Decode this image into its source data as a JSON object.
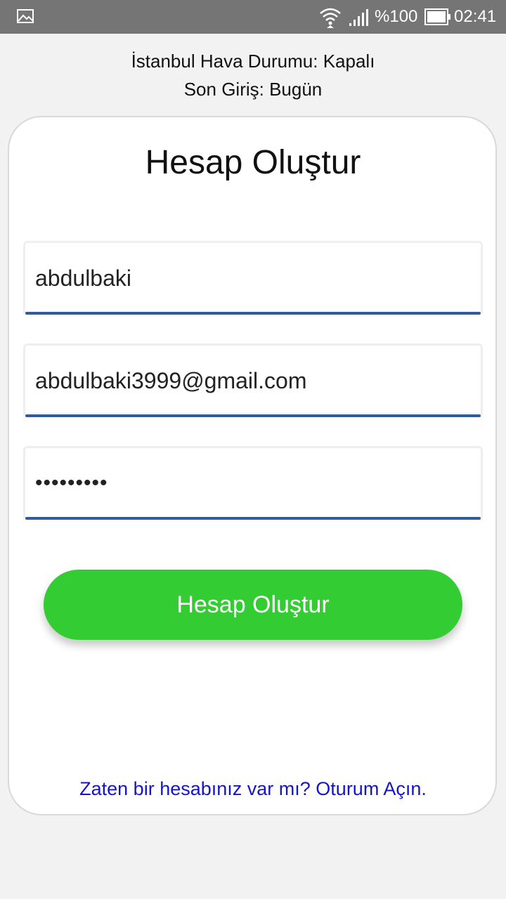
{
  "status_bar": {
    "battery_percent": "%100",
    "time": "02:41",
    "icons": [
      "image-icon",
      "wifi-icon",
      "signal-icon",
      "battery-icon"
    ]
  },
  "info": {
    "weather": "İstanbul Hava Durumu: Kapalı",
    "last_login": "Son Giriş: Bugün"
  },
  "form": {
    "title": "Hesap Oluştur",
    "username": "abdulbaki",
    "email": "abdulbaki3999@gmail.com",
    "password_masked": "•••••••••",
    "submit_label": "Hesap Oluştur"
  },
  "footer": {
    "login_link": "Zaten bir hesabınız var mı? Oturum Açın."
  },
  "colors": {
    "status_bar": "#757575",
    "submit_button": "#33cc33",
    "field_underline": "#2f5d9c",
    "link": "#1515c8"
  }
}
